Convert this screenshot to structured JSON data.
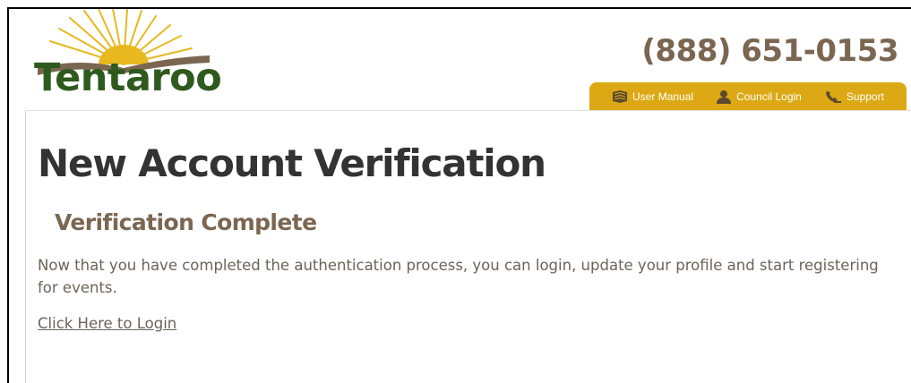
{
  "brand": {
    "logo_text": "Tentaroo",
    "logo_icon": "sunrise-book-logo",
    "colors": {
      "green": "#2f5a1e",
      "gold": "#e8b820",
      "brown": "#7a6651"
    }
  },
  "header": {
    "phone": "(888) 651-0153"
  },
  "nav": {
    "background": "#dca914",
    "items": [
      {
        "label": "User Manual",
        "icon": "book-icon"
      },
      {
        "label": "Council Login",
        "icon": "user-icon"
      },
      {
        "label": "Support",
        "icon": "phone-icon"
      }
    ]
  },
  "main": {
    "title": "New Account Verification",
    "subtitle": "Verification Complete",
    "message": "Now that you have completed the authentication process, you can login, update your profile and start registering for events.",
    "login_link": "Click Here to Login"
  }
}
